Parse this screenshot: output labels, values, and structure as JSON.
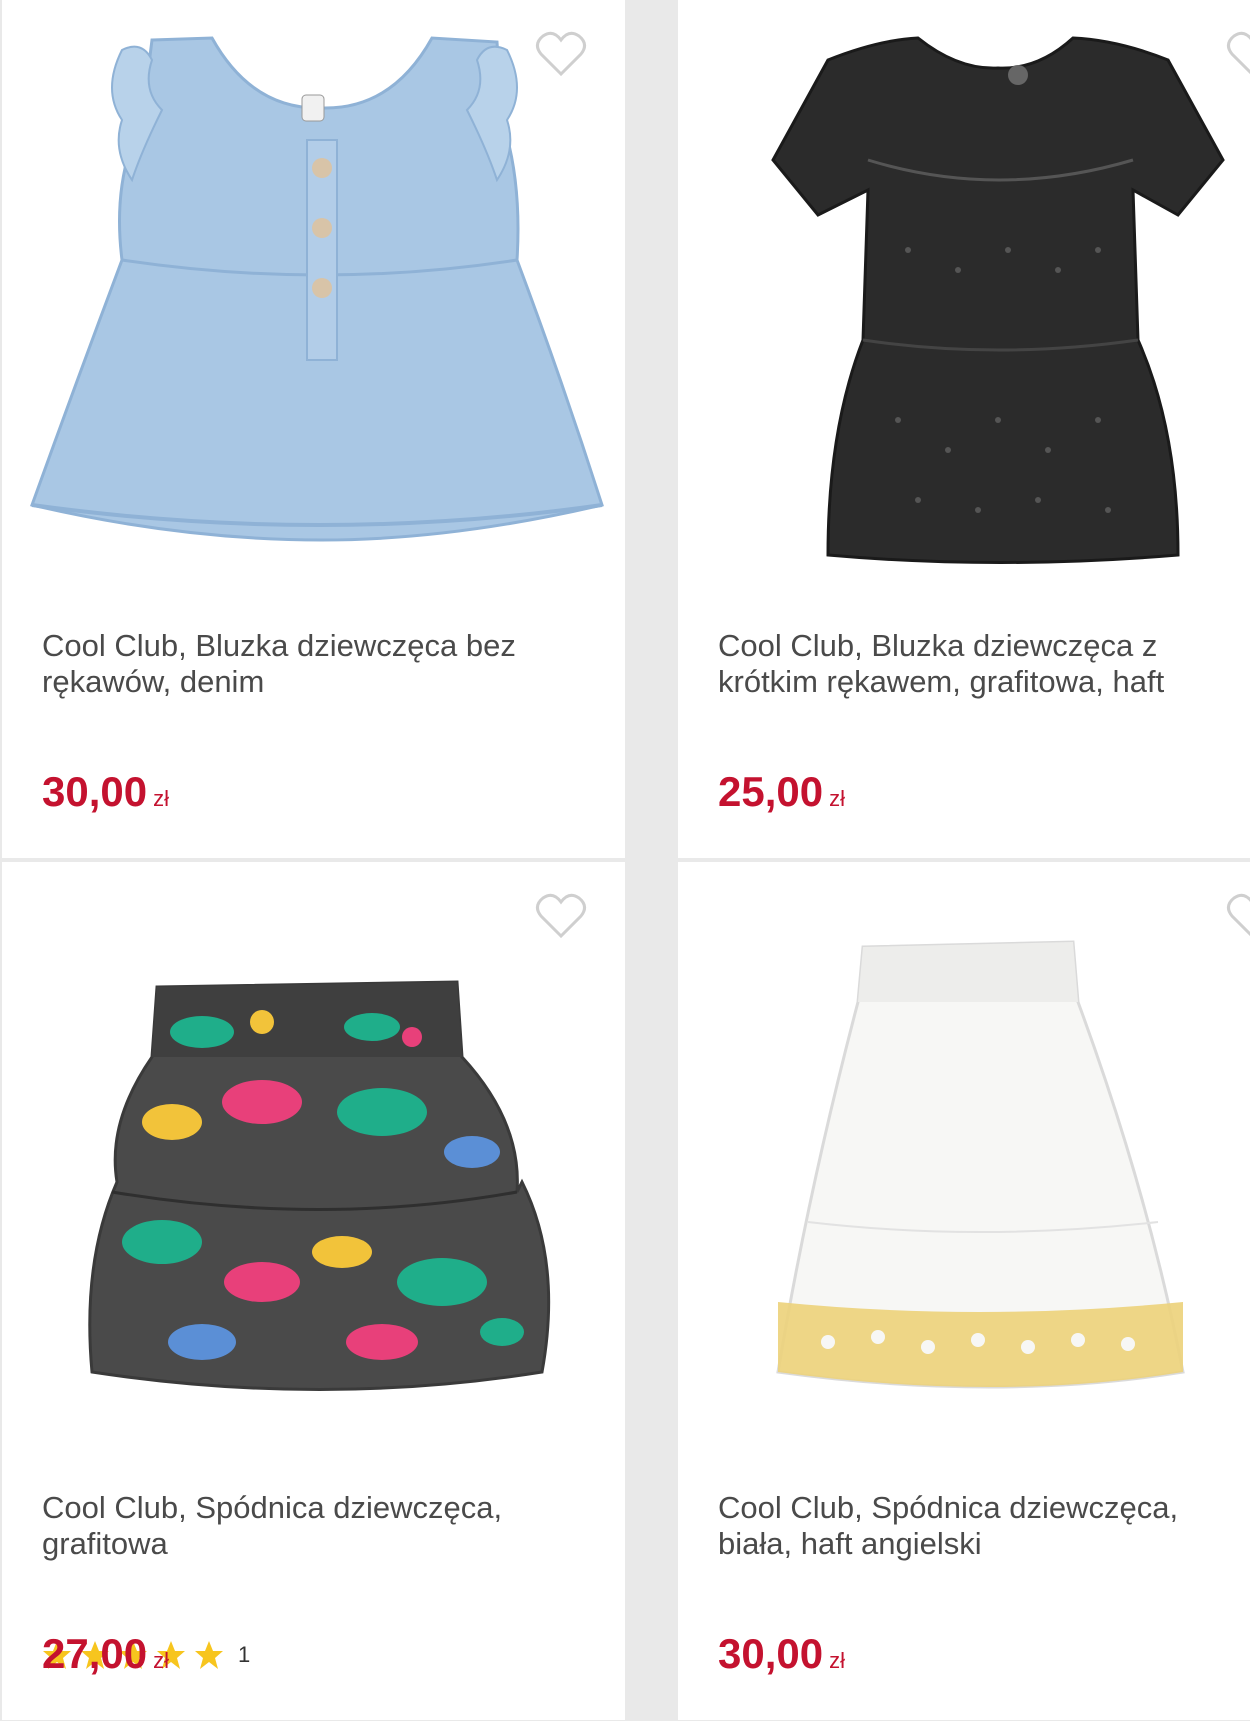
{
  "products": [
    {
      "title": "Cool Club, Bluzka dziewczęca bez rękawów, denim",
      "price": "30,00",
      "currency": "zł",
      "image": "denim-sleeveless-blouse",
      "colors": {
        "main": "#a9c7e4",
        "shade": "#8fb2d6",
        "accent": "#d8c4a8"
      }
    },
    {
      "title": "Cool Club, Bluzka dziewczęca z krótkim rękawem, grafitowa, haft",
      "price": "25,00",
      "currency": "zł",
      "image": "graphite-short-sleeve-blouse",
      "colors": {
        "main": "#2b2b2b",
        "shade": "#1a1a1a"
      }
    },
    {
      "title": "Cool Club, Spódnica dziewczęca, grafitowa",
      "price": "27,00",
      "currency": "zł",
      "rating_stars": 5,
      "rating_count": "1",
      "image": "floral-graphite-skirt",
      "colors": {
        "main": "#4a4a4a",
        "green": "#1fae8a",
        "pink": "#e8407a",
        "yellow": "#f2c33a"
      }
    },
    {
      "title": "Cool Club, Spódnica dziewczęca, biała, haft angielski",
      "price": "30,00",
      "currency": "zł",
      "image": "white-embroidered-skirt",
      "colors": {
        "main": "#f7f7f5",
        "trim": "#ecd27a"
      }
    }
  ],
  "ui": {
    "favorite_icon": "heart-outline-icon",
    "star_icon": "star-icon",
    "price_color": "#c4122f",
    "star_color": "#f7c51e"
  }
}
